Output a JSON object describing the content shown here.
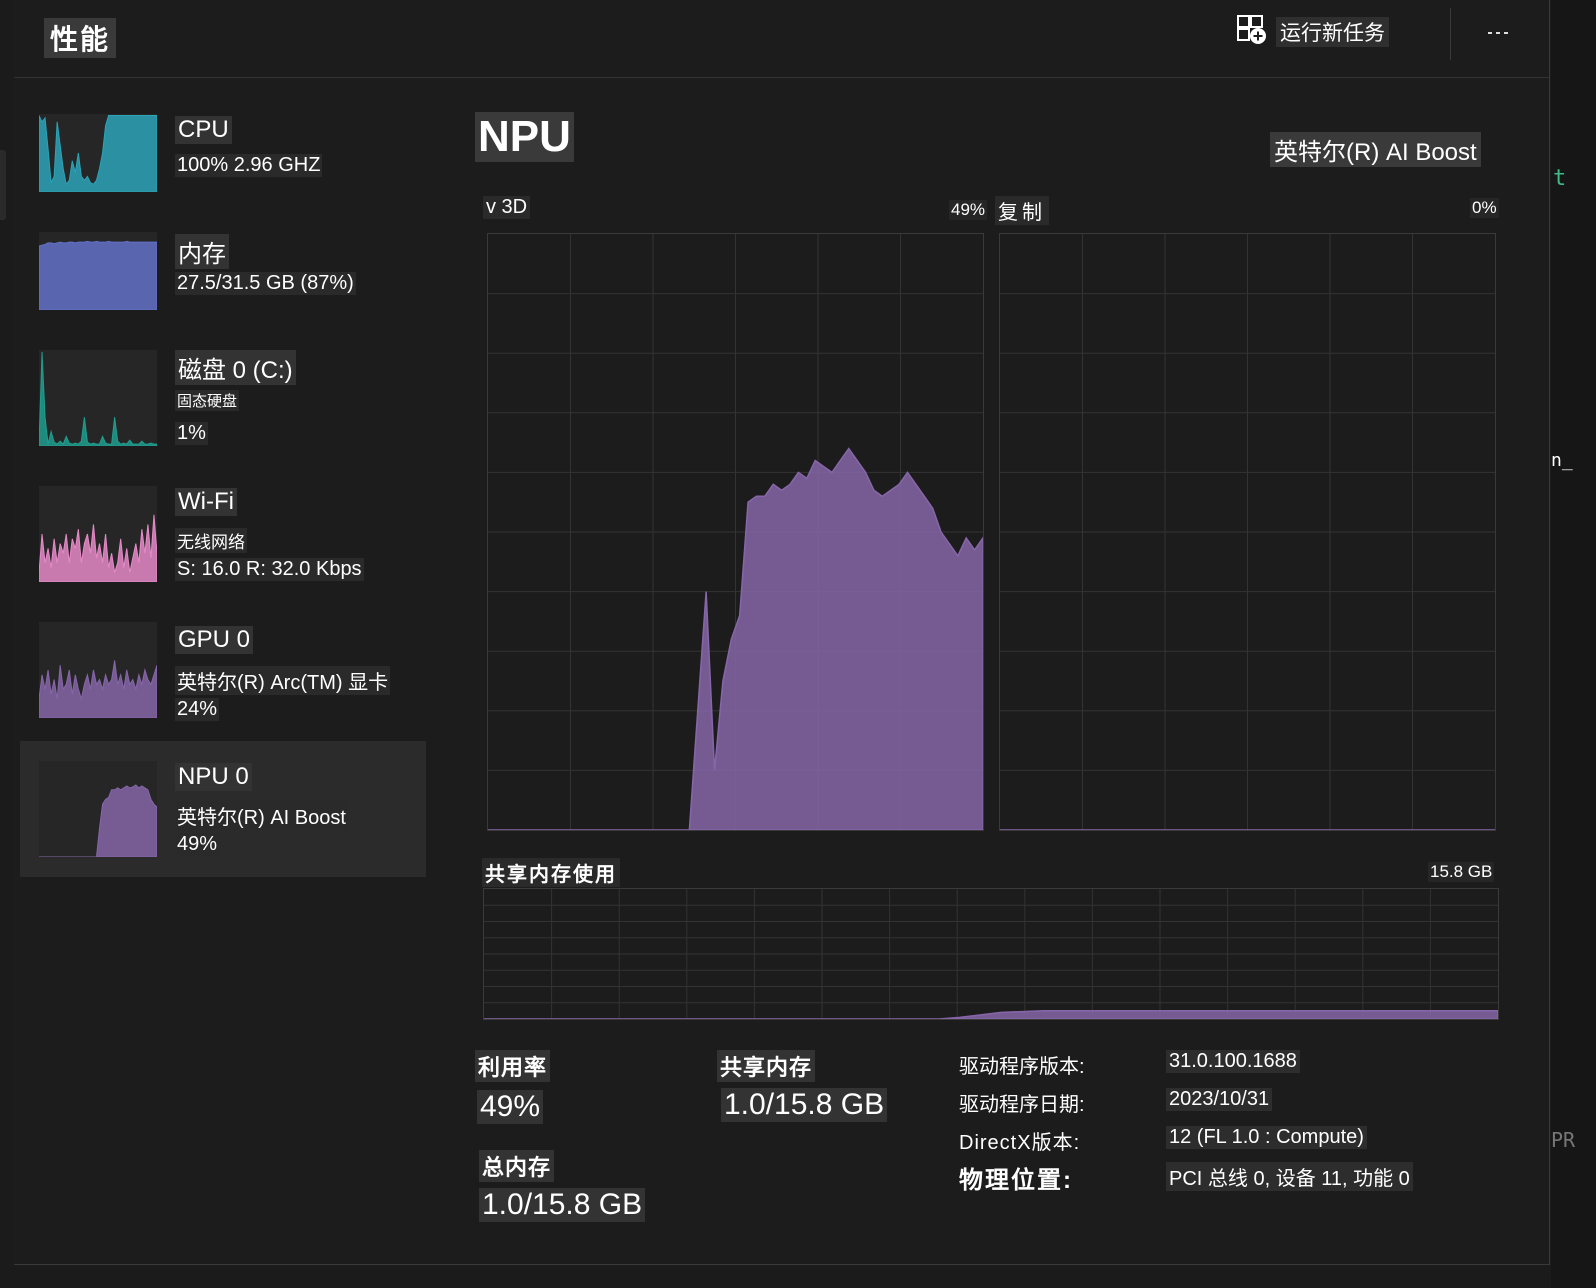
{
  "header": {
    "title": "性能",
    "run_task_label": "运行新任务",
    "more_label": "..."
  },
  "sidebar": {
    "items": [
      {
        "title": "CPU",
        "line1": "100% 2.96 GHZ",
        "line2": "",
        "color": "#2ba3b8",
        "series": [
          0.98,
          0.9,
          0.95,
          0.55,
          0.12,
          0.2,
          0.9,
          0.6,
          0.3,
          0.1,
          0.15,
          0.4,
          0.25,
          0.5,
          0.2,
          0.15,
          0.2,
          0.12,
          0.1,
          0.15,
          0.3,
          0.5,
          0.85,
          0.98,
          0.98,
          0.98,
          0.98,
          0.98,
          0.98,
          0.98,
          0.98,
          0.98,
          0.98,
          0.98,
          0.98,
          0.98,
          0.98,
          0.98,
          0.98,
          0.98
        ]
      },
      {
        "title": "内存",
        "line1": "27.5/31.5 GB (87%)",
        "line2": "",
        "color": "#6371c8",
        "series": [
          0.82,
          0.83,
          0.84,
          0.86,
          0.86,
          0.85,
          0.86,
          0.87,
          0.86,
          0.86,
          0.87,
          0.87,
          0.86,
          0.87,
          0.87,
          0.87,
          0.88,
          0.87,
          0.87,
          0.88,
          0.87,
          0.87,
          0.87,
          0.88,
          0.87,
          0.87,
          0.87,
          0.87,
          0.87,
          0.88,
          0.87,
          0.87,
          0.87,
          0.87,
          0.87,
          0.87,
          0.87,
          0.87,
          0.87,
          0.87
        ]
      },
      {
        "title": "磁盘 0 (C:)",
        "line1": "固态硬盘",
        "line2": "1%",
        "color": "#1f9e8f",
        "series": [
          0.02,
          0.98,
          0.3,
          0.02,
          0.15,
          0.04,
          0.02,
          0.05,
          0.02,
          0.1,
          0.03,
          0.02,
          0.03,
          0.02,
          0.05,
          0.3,
          0.04,
          0.02,
          0.03,
          0.02,
          0.02,
          0.1,
          0.03,
          0.02,
          0.02,
          0.3,
          0.05,
          0.02,
          0.03,
          0.02,
          0.06,
          0.02,
          0.02,
          0.02,
          0.05,
          0.02,
          0.02,
          0.03,
          0.02,
          0.02
        ]
      },
      {
        "title": "Wi-Fi",
        "line1": "无线网络",
        "line2": "S: 16.0 R: 32.0 Kbps",
        "color": "#e58ac8",
        "series": [
          0.1,
          0.5,
          0.2,
          0.35,
          0.15,
          0.45,
          0.2,
          0.4,
          0.3,
          0.5,
          0.2,
          0.45,
          0.35,
          0.55,
          0.2,
          0.4,
          0.5,
          0.3,
          0.6,
          0.25,
          0.4,
          0.2,
          0.5,
          0.15,
          0.3,
          0.1,
          0.2,
          0.45,
          0.15,
          0.35,
          0.1,
          0.25,
          0.4,
          0.2,
          0.55,
          0.3,
          0.6,
          0.25,
          0.7,
          0.3
        ]
      },
      {
        "title": "GPU 0",
        "line1": "英特尔(R) Arc(TM) 显卡",
        "line2": "24%",
        "color": "#8666a8",
        "series": [
          0.2,
          0.45,
          0.3,
          0.5,
          0.25,
          0.4,
          0.2,
          0.55,
          0.3,
          0.35,
          0.5,
          0.25,
          0.45,
          0.3,
          0.2,
          0.35,
          0.45,
          0.3,
          0.5,
          0.35,
          0.4,
          0.3,
          0.45,
          0.35,
          0.4,
          0.6,
          0.35,
          0.45,
          0.3,
          0.5,
          0.35,
          0.4,
          0.3,
          0.45,
          0.35,
          0.5,
          0.4,
          0.35,
          0.45,
          0.55
        ]
      },
      {
        "title": "NPU 0",
        "line1": "英特尔(R) AI Boost",
        "line2": "49%",
        "color": "#8666a8",
        "series": [
          0,
          0,
          0,
          0,
          0,
          0,
          0,
          0,
          0,
          0,
          0,
          0,
          0,
          0,
          0,
          0,
          0,
          0,
          0,
          0,
          0.3,
          0.55,
          0.6,
          0.62,
          0.7,
          0.7,
          0.72,
          0.7,
          0.72,
          0.74,
          0.72,
          0.73,
          0.75,
          0.72,
          0.74,
          0.72,
          0.7,
          0.6,
          0.55,
          0.52
        ]
      }
    ],
    "selected_index": 5
  },
  "main": {
    "title": "NPU",
    "device_name": "英特尔(R) AI Boost",
    "graph1": {
      "label": "v 3D",
      "value": "49%"
    },
    "graph2": {
      "label": "复制",
      "value": "0%"
    },
    "shared_graph": {
      "label": "共享内存使用",
      "value": "15.8 GB"
    },
    "stats": {
      "utilization_label": "利用率",
      "utilization_value": "49%",
      "shared_label": "共享内存",
      "shared_value": "1.0/15.8 GB",
      "total_label": "总内存",
      "total_value": "1.0/15.8 GB"
    },
    "details": [
      {
        "key": "驱动程序版本:",
        "value": "31.0.100.1688"
      },
      {
        "key": "驱动程序日期:",
        "value": "2023/10/31"
      },
      {
        "key": "DirectX版本:",
        "value": "12 (FL 1.0 : Compute)"
      },
      {
        "key": "物理位置:",
        "value": "PCI 总线 0, 设备 11, 功能 0"
      }
    ]
  },
  "colors": {
    "accent_npu": "#8666a8",
    "grid": "#333333",
    "background": "#1c1c1c"
  },
  "icons": {
    "run_task": "new-task-icon",
    "more": "more-horizontal-icon"
  },
  "edge_fragments": {
    "top": "t",
    "middle": "n_",
    "bottom": "PR"
  },
  "chart_data": [
    {
      "type": "area",
      "title": "v 3D",
      "ylabel": "",
      "ylim": [
        0,
        100
      ],
      "x": [
        0,
        1,
        2,
        3,
        4,
        5,
        6,
        7,
        8,
        9,
        10,
        11,
        12,
        13,
        14,
        15,
        16,
        17,
        18,
        19,
        20,
        21,
        22,
        23,
        24,
        25,
        26,
        27,
        28,
        29,
        30,
        31,
        32,
        33,
        34,
        35,
        36,
        37,
        38,
        39,
        40,
        41,
        42,
        43,
        44,
        45,
        46,
        47,
        48,
        49,
        50,
        51,
        52,
        53,
        54,
        55,
        56,
        57,
        58,
        59
      ],
      "series": [
        {
          "values": [
            0,
            0,
            0,
            0,
            0,
            0,
            0,
            0,
            0,
            0,
            0,
            0,
            0,
            0,
            0,
            0,
            0,
            0,
            0,
            0,
            0,
            0,
            0,
            0,
            0,
            0,
            0,
            0,
            0,
            0,
            0,
            0,
            0,
            0,
            0,
            0,
            0,
            0,
            0,
            0,
            0,
            0,
            0,
            0,
            0,
            0,
            0,
            0,
            0,
            0,
            0,
            0,
            0,
            0,
            0,
            0,
            0,
            0,
            0,
            0
          ]
        }
      ],
      "npu_values": [
        0,
        0,
        0,
        0,
        0,
        0,
        0,
        0,
        0,
        0,
        0,
        0,
        0,
        0,
        0,
        0,
        0,
        0,
        0,
        0,
        0,
        0,
        0,
        0,
        0,
        20,
        40,
        10,
        25,
        32,
        36,
        55,
        56,
        56,
        58,
        57,
        58,
        60,
        59,
        62,
        61,
        60,
        62,
        64,
        62,
        60,
        57,
        56,
        57,
        58,
        60,
        58,
        56,
        54,
        50,
        48,
        46,
        49,
        47,
        49
      ],
      "grid": true
    },
    {
      "type": "area",
      "title": "复制",
      "ylim": [
        0,
        100
      ],
      "series": [
        {
          "values": [
            0,
            0,
            0,
            0,
            0,
            0,
            0,
            0,
            0,
            0,
            0,
            0,
            0,
            0,
            0,
            0,
            0,
            0,
            0,
            0,
            0,
            0,
            0,
            0,
            0,
            0,
            0,
            0,
            0,
            0
          ]
        }
      ],
      "grid": true
    },
    {
      "type": "area",
      "title": "共享内存使用",
      "ylim": [
        0,
        15.8
      ],
      "series": [
        {
          "values": [
            0,
            0,
            0,
            0,
            0,
            0,
            0,
            0,
            0,
            0,
            0,
            0,
            0,
            0,
            0,
            0,
            0,
            0,
            0,
            0,
            0,
            0,
            0,
            0.2,
            0.5,
            0.8,
            0.9,
            1.0,
            1.0,
            1.0,
            1.0,
            1.0,
            1.0,
            1.0,
            1.0,
            1.0,
            1.0,
            1.0,
            1.0,
            1.0,
            1.0,
            1.0,
            1.0,
            1.0,
            1.0,
            1.0,
            1.0,
            1.0,
            1.0,
            1.0
          ]
        }
      ],
      "grid": true
    }
  ]
}
